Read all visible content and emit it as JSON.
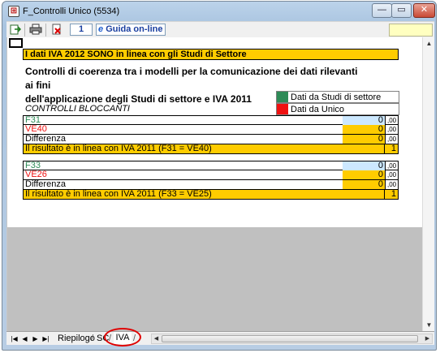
{
  "window": {
    "title": "F_Controlli Unico (5534)",
    "minimize": "—",
    "maximize": "▭",
    "close": "✕"
  },
  "toolbar": {
    "page_number": "1",
    "guida_label": "Guida on-line"
  },
  "sheet": {
    "banner": "I dati IVA 2012 SONO in linea con gli Studi di Settore",
    "heading_line1": "Controlli di coerenza  tra i modelli per la comunicazione dei dati rilevanti ai fini",
    "heading_line2": "dell'applicazione degli Studi di settore e IVA 2011",
    "legend": [
      {
        "label": "Dati da Studi di settore",
        "color": "#2e8b57"
      },
      {
        "label": "Dati da Unico",
        "color": "#ee1111"
      }
    ],
    "section_title": "CONTROLLI BLOCCANTI",
    "block1": {
      "rows": [
        {
          "label": "F31",
          "value": "0",
          "decimal": ",00",
          "label_color": "#2e8b57"
        },
        {
          "label": "VE40",
          "value": "0",
          "decimal": ",00",
          "label_color": "#ee1111"
        },
        {
          "label": "Differenza",
          "value": "0",
          "decimal": ",00",
          "label_color": "#000000"
        }
      ],
      "result_label": "Il risultato è in linea con IVA 2011 (F31 = VE40)",
      "result_value": "1"
    },
    "block2": {
      "rows": [
        {
          "label": "F33",
          "value": "0",
          "decimal": ",00",
          "label_color": "#2e8b57"
        },
        {
          "label": "VE26",
          "value": "0",
          "decimal": ",00",
          "label_color": "#ee1111"
        },
        {
          "label": "Differenza",
          "value": "0",
          "decimal": ",00",
          "label_color": "#000000"
        }
      ],
      "result_label": "Il risultato è in linea con IVA 2011 (F33 = VE25)",
      "result_value": "1"
    }
  },
  "tabs": {
    "riepilogo": "Riepilogo",
    "sc": "SC",
    "iva": "IVA",
    "active": "IVA"
  }
}
